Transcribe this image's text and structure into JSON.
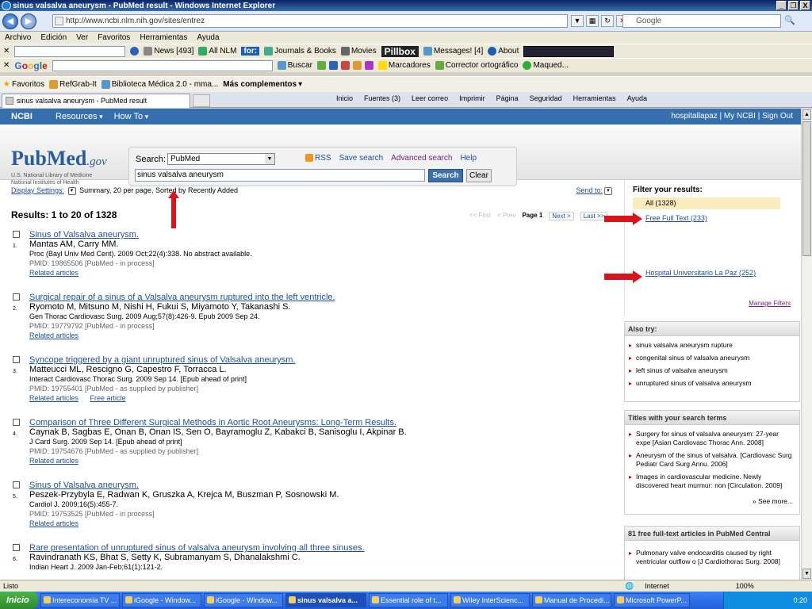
{
  "window": {
    "title": "sinus valsalva aneurysm - PubMed result - Windows Internet Explorer",
    "controls": [
      "_",
      "❐",
      "X"
    ]
  },
  "address": {
    "url": "http://www.ncbi.nlm.nih.gov/sites/entrez",
    "search_placeholder": "Google"
  },
  "menu": [
    "Archivo",
    "Edición",
    "Ver",
    "Favoritos",
    "Herramientas",
    "Ayuda"
  ],
  "toolbar1": {
    "news": "News [493]",
    "allnlm": "All NLM",
    "for": "for:",
    "journals": "Journals & Books",
    "movies": "Movies",
    "pillbox": "Pillbox",
    "messages": "Messages! [4]",
    "about": "About"
  },
  "toolbar2": {
    "google": "Google",
    "buscar": "Buscar",
    "marcadores": "Marcadores",
    "corrector": "Corrector ortográfico",
    "user": "Maqued..."
  },
  "toolbar3": {
    "favoritos": "Favoritos",
    "refgrab": "RefGrab-It",
    "biblioteca": "Biblioteca Médica 2.0 - mma...",
    "complementos": "Más complementos"
  },
  "tab": {
    "title": "sinus valsalva aneurysm - PubMed result"
  },
  "commands": [
    "Inicio",
    "Fuentes (3)",
    "Leer correo",
    "Imprimir",
    "Página",
    "Seguridad",
    "Herramientas",
    "Ayuda"
  ],
  "ncbi": {
    "logo": "NCBI",
    "resources": "Resources",
    "howto": "How To",
    "user": "hospitallapaz",
    "my_ncbi": "My NCBI",
    "sign_out": "Sign Out",
    "sep": "|"
  },
  "pubmed": {
    "logo_pub": "Pub",
    "logo_med": "Med",
    "logo_gov": ".gov",
    "sub1": "U.S. National Library of Medicine",
    "sub2": "National Institutes of Health",
    "search_label": "Search:",
    "db": "PubMed",
    "rss": "RSS",
    "save_search": "Save search",
    "advanced": "Advanced search",
    "help": "Help",
    "term": "sinus valsalva aneurysm",
    "search_btn": "Search",
    "clear_btn": "Clear"
  },
  "display": {
    "settings": "Display Settings:",
    "summary": "Summary, 20 per page, Sorted by Recently Added",
    "send_to": "Send to:"
  },
  "results": {
    "heading": "Results: 1 to 20 of 1328",
    "pager": {
      "first": "<< First",
      "prev": "< Prev",
      "page": "Page 1",
      "next": "Next >",
      "last": "Last >>"
    },
    "items": [
      {
        "num": "1.",
        "title": "Sinus of Valsalva aneurysm.",
        "authors": "Mantas AM, Carry MM.",
        "source": "Proc (Bayl Univ Med Cent). 2009 Oct;22(4):338. No abstract available.",
        "pmid": "PMID: 19865506 [PubMed - in process]",
        "links": [
          "Related articles"
        ]
      },
      {
        "num": "2.",
        "title": "Surgical repair of a sinus of a Valsalva aneurysm ruptured into the left ventricle.",
        "authors": "Ryomoto M, Mitsuno M, Nishi H, Fukui S, Miyamoto Y, Takanashi S.",
        "source": "Gen Thorac Cardiovasc Surg. 2009 Aug;57(8):426-9. Epub 2009 Sep 24.",
        "pmid": "PMID: 19779792 [PubMed - in process]",
        "links": [
          "Related articles"
        ]
      },
      {
        "num": "3.",
        "title": "Syncope triggered by a giant unruptured sinus of Valsalva aneurysm.",
        "authors": "Matteucci ML, Rescigno G, Capestro F, Torracca L.",
        "source": "Interact Cardiovasc Thorac Surg. 2009 Sep 14. [Epub ahead of print]",
        "pmid": "PMID: 19755401 [PubMed - as supplied by publisher]",
        "links": [
          "Related articles",
          "Free article"
        ]
      },
      {
        "num": "4.",
        "title": "Comparison of Three Different Surgical Methods in Aortic Root Aneurysms: Long-Term Results.",
        "authors": "Caynak B, Sagbas E, Onan B, Onan IS, Sen O, Bayramoglu Z, Kabakci B, Sanisoglu I, Akpinar B.",
        "source": "J Card Surg. 2009 Sep 14. [Epub ahead of print]",
        "pmid": "PMID: 19754676 [PubMed - as supplied by publisher]",
        "links": [
          "Related articles"
        ]
      },
      {
        "num": "5.",
        "title": "Sinus of Valsalva aneurysm.",
        "authors": "Peszek-Przybyla E, Radwan K, Gruszka A, Krejca M, Buszman P, Sosnowski M.",
        "source": "Cardiol J. 2009;16(5):455-7.",
        "pmid": "PMID: 19753525 [PubMed - in process]",
        "links": [
          "Related articles"
        ]
      },
      {
        "num": "6.",
        "title": "Rare presentation of unruptured sinus of valsalva aneurysm involving all three sinuses.",
        "authors": "Ravindranath KS, Bhat S, Setty K, Subramanyam S, Dhanalakshmi C.",
        "source": "Indian Heart J. 2009 Jan-Feb;61(1):121-2.",
        "pmid": "",
        "links": []
      }
    ]
  },
  "filters": {
    "title": "Filter your results:",
    "all": "All (1328)",
    "free_full_text": "Free Full Text (233)",
    "hospital": "Hospital Universitario La Paz (252)",
    "manage": "Manage Filters"
  },
  "also_try": {
    "title": "Also try:",
    "items": [
      "sinus valsalva aneurysm rupture",
      "congenital sinus of valsalva aneurysm",
      "left sinus of valsalva aneurysm",
      "unruptured sinus of valsalva aneurysm"
    ]
  },
  "titles_terms": {
    "title": "Titles with your search terms",
    "items": [
      "Surgery for sinus of valsalva aneurysm: 27-year expe [Asian Cardiovasc Thorac Ann. 2008]",
      "Aneurysm of the sinus of valsalva. [Cardiovasc Surg Pediatr Card Surg Annu. 2006]",
      "Images in cardiovascular medicine. Newly discovered heart murmur: non [Circulation. 2009]"
    ],
    "see_more": "» See more..."
  },
  "pmc": {
    "title": "81 free full-text articles in PubMed Central",
    "items": [
      "Pulmonary valve endocarditis caused by right ventricular outflow o [J Cardiothorac Surg. 2008]"
    ]
  },
  "status": {
    "left": "Listo",
    "zone": "Internet",
    "zoom": "100%"
  },
  "taskbar": {
    "start": "Inicio",
    "tasks": [
      "Intereconomía TV ...",
      "iGoogle - Window...",
      "iGoogle - Window...",
      "sinus valsalva a...",
      "Essential role of t...",
      "Wiley InterScienc...",
      "Manual de Procedi...",
      "Microsoft PowerP..."
    ],
    "clock": "0:20"
  }
}
